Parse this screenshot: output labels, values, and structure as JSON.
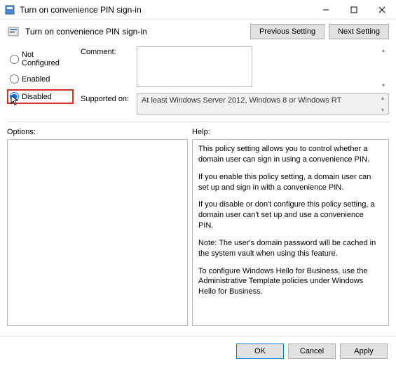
{
  "window": {
    "title": "Turn on convenience PIN sign-in"
  },
  "header": {
    "policy_title": "Turn on convenience PIN sign-in",
    "prev_btn": "Previous Setting",
    "next_btn": "Next Setting"
  },
  "state": {
    "not_configured": "Not Configured",
    "enabled": "Enabled",
    "disabled": "Disabled",
    "selected": "disabled"
  },
  "fields": {
    "comment_label": "Comment:",
    "comment_value": "",
    "supported_label": "Supported on:",
    "supported_value": "At least Windows Server 2012, Windows 8 or Windows RT"
  },
  "panels": {
    "options_label": "Options:",
    "help_label": "Help:"
  },
  "help": {
    "p1": "This policy setting allows you to control whether a domain user can sign in using a convenience PIN.",
    "p2": "If you enable this policy setting, a domain user can set up and sign in with a convenience PIN.",
    "p3": "If you disable or don't configure this policy setting, a domain user can't set up and use a convenience PIN.",
    "p4": "Note: The user's domain password will be cached in the system vault when using this feature.",
    "p5": "To configure Windows Hello for Business, use the Administrative Template policies under Windows Hello for Business."
  },
  "footer": {
    "ok": "OK",
    "cancel": "Cancel",
    "apply": "Apply"
  }
}
